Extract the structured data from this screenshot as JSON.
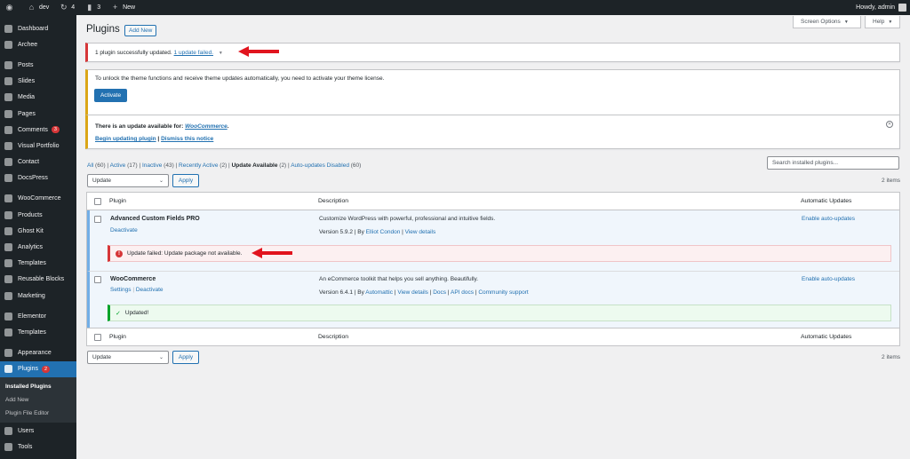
{
  "adminbar": {
    "site_name": "dev",
    "updates_count": "4",
    "comments_count": "3",
    "new_label": "New",
    "howdy": "Howdy, admin"
  },
  "sidebar": {
    "items": [
      {
        "label": "Dashboard",
        "icon": "dashboard-icon"
      },
      {
        "label": "Archee",
        "icon": "archee-icon"
      },
      {
        "label": "Posts",
        "icon": "pin-icon"
      },
      {
        "label": "Slides",
        "icon": "slides-icon"
      },
      {
        "label": "Media",
        "icon": "media-icon"
      },
      {
        "label": "Pages",
        "icon": "pages-icon"
      },
      {
        "label": "Comments",
        "icon": "comment-icon",
        "badge": "3"
      },
      {
        "label": "Visual Portfolio",
        "icon": "portfolio-icon"
      },
      {
        "label": "Contact",
        "icon": "mail-icon"
      },
      {
        "label": "DocsPress",
        "icon": "docs-icon"
      },
      {
        "label": "WooCommerce",
        "icon": "woo-icon"
      },
      {
        "label": "Products",
        "icon": "archive-icon"
      },
      {
        "label": "Ghost Kit",
        "icon": "ghost-icon"
      },
      {
        "label": "Analytics",
        "icon": "chart-icon"
      },
      {
        "label": "Templates",
        "icon": "templates-icon"
      },
      {
        "label": "Reusable Blocks",
        "icon": "blocks-icon"
      },
      {
        "label": "Marketing",
        "icon": "megaphone-icon"
      },
      {
        "label": "Elementor",
        "icon": "elementor-icon"
      },
      {
        "label": "Templates",
        "icon": "folder-icon"
      },
      {
        "label": "Appearance",
        "icon": "brush-icon"
      },
      {
        "label": "Plugins",
        "icon": "plugin-icon",
        "badge": "2"
      },
      {
        "label": "Users",
        "icon": "users-icon"
      },
      {
        "label": "Tools",
        "icon": "tools-icon"
      }
    ],
    "plugins_submenu": [
      "Installed Plugins",
      "Add New",
      "Plugin File Editor"
    ]
  },
  "screen_options": "Screen Options",
  "help": "Help",
  "page_title": "Plugins",
  "add_new": "Add New",
  "notice_update": {
    "text": "1 plugin successfully updated.",
    "link": "1 update failed."
  },
  "notice_license": {
    "text": "To unlock the theme functions and receive theme updates automatically, you need to activate your theme license.",
    "button": "Activate"
  },
  "notice_woo": {
    "text": "There is an update available for:",
    "plugin": "WooCommerce",
    "period": ".",
    "begin": "Begin updating plugin",
    "sep": "|",
    "dismiss": "Dismiss this notice"
  },
  "filters": {
    "all": "All",
    "all_count": "(60)",
    "active": "Active",
    "active_count": "(17)",
    "inactive": "Inactive",
    "inactive_count": "(43)",
    "recently": "Recently Active",
    "recently_count": "(2)",
    "update": "Update Available",
    "update_count": "(2)",
    "autodisabled": "Auto-updates Disabled",
    "autodisabled_count": "(60)"
  },
  "search_placeholder": "Search installed plugins...",
  "bulk": {
    "select": "Update",
    "apply": "Apply",
    "items": "2 items"
  },
  "table": {
    "col_plugin": "Plugin",
    "col_description": "Description",
    "col_auto": "Automatic Updates",
    "rows": [
      {
        "name": "Advanced Custom Fields PRO",
        "action1": "Deactivate",
        "description": "Customize WordPress with powerful, professional and intuitive fields.",
        "version": "Version 5.9.2 | By",
        "author": "Elliot Condon",
        "details": "View details",
        "auto": "Enable auto-updates",
        "notice": "Update failed: Update package not available."
      },
      {
        "name": "WooCommerce",
        "action1": "Settings",
        "action2": "Deactivate",
        "description": "An eCommerce toolkit that helps you sell anything. Beautifully.",
        "version": "Version 6.4.1 | By",
        "author": "Automattic",
        "details": "View details",
        "docs": "Docs",
        "api": "API docs",
        "support": "Community support",
        "auto": "Enable auto-updates",
        "notice": "Updated!"
      }
    ]
  },
  "colors": {
    "accent": "#2271b1",
    "error": "#d63638",
    "success": "#00a32a",
    "warning": "#dba617",
    "annotation": "#e1141e"
  }
}
